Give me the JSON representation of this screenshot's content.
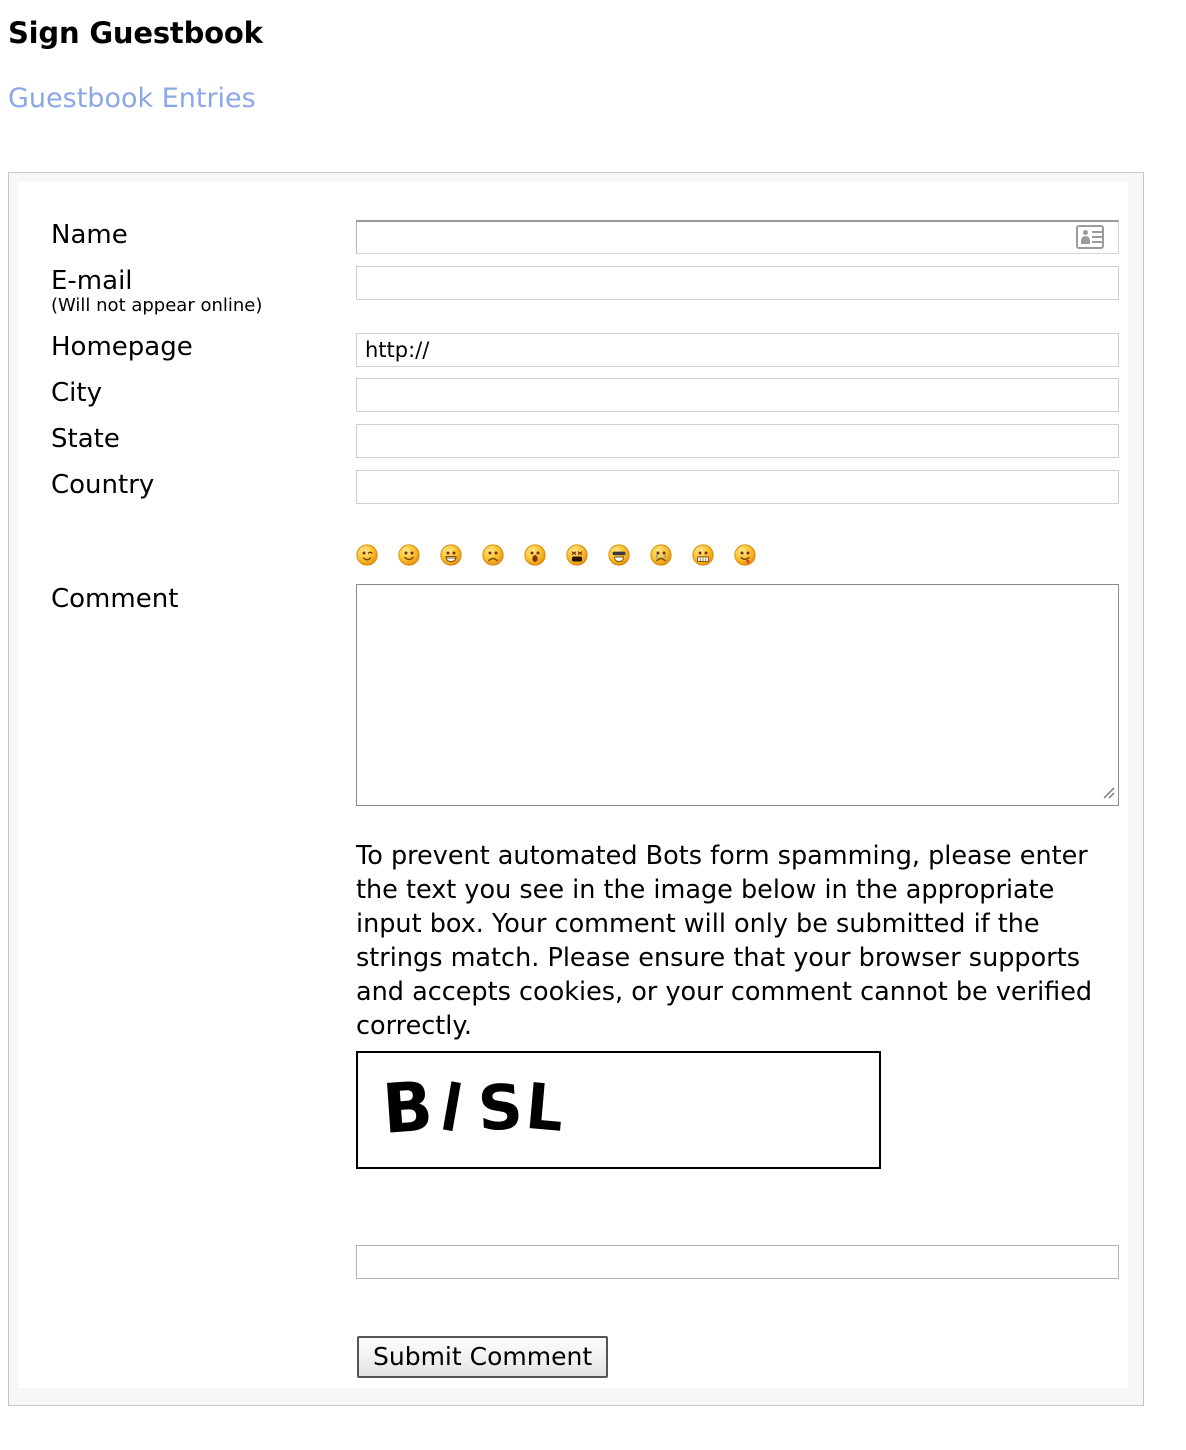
{
  "header": {
    "title": "Sign Guestbook",
    "entries_link": "Guestbook Entries"
  },
  "form": {
    "fields": [
      {
        "label": "Name",
        "sublabel": "",
        "value": "",
        "placeholder": "",
        "icon": "contact-card-icon",
        "name": "name"
      },
      {
        "label": "E-mail",
        "sublabel": "(Will not appear online)",
        "value": "",
        "placeholder": "",
        "icon": "",
        "name": "email"
      },
      {
        "label": "Homepage",
        "sublabel": "",
        "value": "http://",
        "placeholder": "",
        "icon": "",
        "name": "homepage"
      },
      {
        "label": "City",
        "sublabel": "",
        "value": "",
        "placeholder": "",
        "icon": "",
        "name": "city"
      },
      {
        "label": "State",
        "sublabel": "",
        "value": "",
        "placeholder": "",
        "icon": "",
        "name": "state"
      },
      {
        "label": "Country",
        "sublabel": "",
        "value": "",
        "placeholder": "",
        "icon": "",
        "name": "country"
      }
    ],
    "comment": {
      "label": "Comment",
      "value": "",
      "placeholder": ""
    },
    "emoticons": [
      {
        "name": "smiley-wink-icon",
        "title": "wink"
      },
      {
        "name": "smiley-smile-icon",
        "title": "smile"
      },
      {
        "name": "smiley-grin-icon",
        "title": "grin"
      },
      {
        "name": "smiley-sad-icon",
        "title": "sad"
      },
      {
        "name": "smiley-surprised-icon",
        "title": "surprised"
      },
      {
        "name": "smiley-shout-icon",
        "title": "shout"
      },
      {
        "name": "smiley-cool-icon",
        "title": "cool"
      },
      {
        "name": "smiley-cry-icon",
        "title": "cry"
      },
      {
        "name": "smiley-grit-teeth-icon",
        "title": "gritted teeth"
      },
      {
        "name": "smiley-tongue-icon",
        "title": "tongue out"
      }
    ],
    "captcha": {
      "instructions": "To prevent automated Bots form spamming, please enter the text you see in the image below in the appropriate input box. Your comment will only be submitted if the strings match. Please ensure that your browser supports and accepts cookies, or your comment cannot be verified correctly.",
      "image_text": "BISL",
      "input_value": "",
      "input_placeholder": ""
    },
    "submit_label": "Submit Comment"
  },
  "colors": {
    "link": "#8aa8e8",
    "frame_border": "#c6c6c6",
    "frame_bg": "#f7f7f7",
    "input_border": "#cfcfcf",
    "textarea_border": "#8a8a8a",
    "emoticon_face": "#fbc02d",
    "captcha_border": "#000000"
  }
}
